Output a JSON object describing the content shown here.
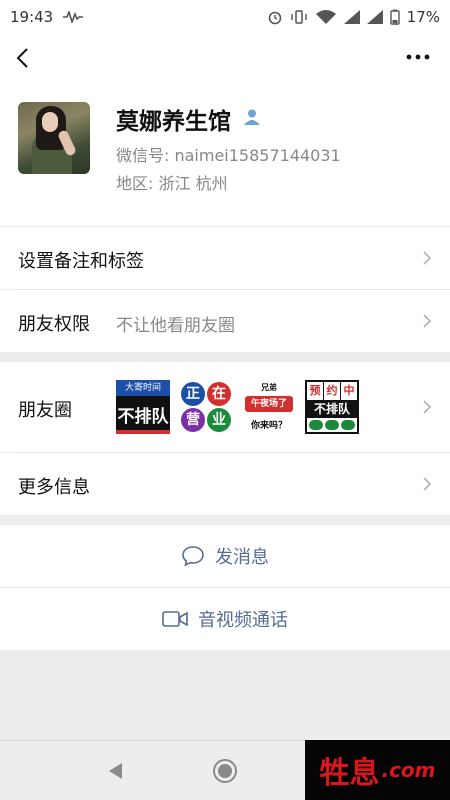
{
  "status_bar": {
    "time": "19:43",
    "battery": "17%"
  },
  "profile": {
    "name": "莫娜养生馆",
    "wechat_id": "微信号: naimei15857144031",
    "region": "地区: 浙江  杭州"
  },
  "rows": {
    "remark_label": "设置备注和标签",
    "permission_label": "朋友权限",
    "permission_value": "不让他看朋友圈",
    "moments_label": "朋友圈",
    "more_info_label": "更多信息"
  },
  "moments_thumbs": [
    {
      "top": "大寄时间",
      "big": "不排队"
    },
    {
      "c1": "正",
      "c2": "在",
      "c3": "营",
      "c4": "业"
    },
    {
      "l1": "兄弟",
      "l2": "午夜场了",
      "l3": "你来吗？"
    },
    {
      "a": "预",
      "b": "约",
      "c": "中",
      "row2": "不排队"
    }
  ],
  "actions": {
    "message": "发消息",
    "video_call": "音视频通话"
  },
  "watermark": {
    "cn": "牲息",
    "en": ".com"
  },
  "colors": {
    "link": "#576b95",
    "background": "#ededed",
    "accent_red": "#d9161b"
  }
}
